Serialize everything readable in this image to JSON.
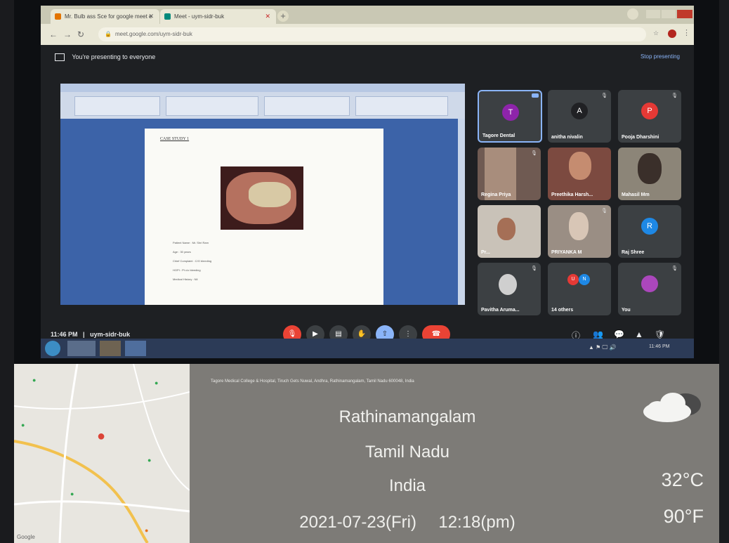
{
  "browser": {
    "tabs": [
      {
        "label": "Mr. Bulb ass Sce for google meet e"
      },
      {
        "label": "Meet - uym-sidr-buk"
      }
    ],
    "url": "meet.google.com/uym-sidr-buk"
  },
  "meet": {
    "presenting_text": "You're presenting to everyone",
    "stop_presenting": "Stop presenting",
    "meeting_time": "11:46 PM",
    "meeting_code": "uym-sidr-buk",
    "participants": [
      {
        "name": "Tagore Dental",
        "initial": "T",
        "color": "#8e24aa"
      },
      {
        "name": "anitha nivalin",
        "initial": "A",
        "color": "#202124"
      },
      {
        "name": "Pooja Dharshini",
        "initial": "P",
        "color": "#e53935"
      },
      {
        "name": "Regina Priya",
        "initial": "",
        "color": ""
      },
      {
        "name": "Preethika Harsh...",
        "initial": "",
        "color": ""
      },
      {
        "name": "Mahasil Mm",
        "initial": "",
        "color": ""
      },
      {
        "name": "Pr...",
        "initial": "",
        "color": ""
      },
      {
        "name": "PRIYANKA M",
        "initial": "",
        "color": ""
      },
      {
        "name": "Raj Shree",
        "initial": "R",
        "color": "#1e88e5"
      },
      {
        "name": "Pavitha Aruma...",
        "initial": "",
        "color": ""
      },
      {
        "name": "14 others",
        "initial": "",
        "color": ""
      },
      {
        "name": "You",
        "initial": "",
        "color": "#ab47bc"
      }
    ],
    "others_avatars": [
      "U",
      "N"
    ]
  },
  "document": {
    "heading": "CASE STUDY 1",
    "lines": [
      "Patient Name : Mr. Shri Ram",
      "Age : 30 years",
      "Chief Complaint : C/O bleeding",
      "HOPI : Pt c/o bleeding",
      "Medical History : Nil"
    ]
  },
  "taskbar": {
    "clock": "11:46 PM"
  },
  "overlay": {
    "address": "Tagore Medical College & Hospital, Tiruch Gets Nuwal, Andhra, Rathinamangalam, Tamil Nadu 600048, India",
    "city": "Rathinamangalam",
    "state": "Tamil Nadu",
    "country": "India",
    "date": "2021-07-23(Fri)",
    "time": "12:18(pm)",
    "temp_c": "32°C",
    "temp_f": "90°F",
    "map_logo": "Google"
  },
  "colors": {
    "meet_bg": "#202124",
    "end_call": "#ea4335",
    "overlay_bg": "#7d7b77"
  }
}
